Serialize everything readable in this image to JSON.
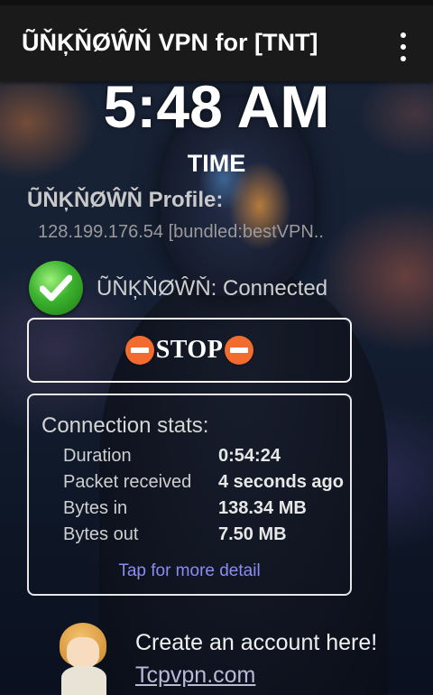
{
  "app": {
    "title": "ŨŇĶŇØŴŇ VPN for [TNT]",
    "menu_icon": "overflow-menu-icon"
  },
  "clock": {
    "time": "5:48 AM",
    "label": "TIME"
  },
  "profile": {
    "label": "ŨŇĶŇØŴŇ Profile:",
    "value": "128.199.176.54 [bundled:bestVPN.."
  },
  "connection": {
    "status_icon": "check-icon",
    "status_text": "ŨŇĶŇØŴŇ: Connected",
    "status_color": "#3bb22d"
  },
  "stop_button": {
    "label": "STOP",
    "icon": "minus-circle-icon",
    "icon_color": "#f26b2f"
  },
  "stats": {
    "title": "Connection stats:",
    "rows": [
      {
        "key": "Duration",
        "value": "0:54:24"
      },
      {
        "key": "Packet received",
        "value": "4 seconds ago"
      },
      {
        "key": "Bytes in",
        "value": "138.34 MB"
      },
      {
        "key": "Bytes out",
        "value": "7.50 MB"
      }
    ],
    "detail_link": "Tap for more detail",
    "link_color": "#8c8cf0"
  },
  "promo": {
    "text": "Create an account here!",
    "link": "Tcpvpn.com",
    "avatar_icon": "cartoon-avatar-icon"
  }
}
